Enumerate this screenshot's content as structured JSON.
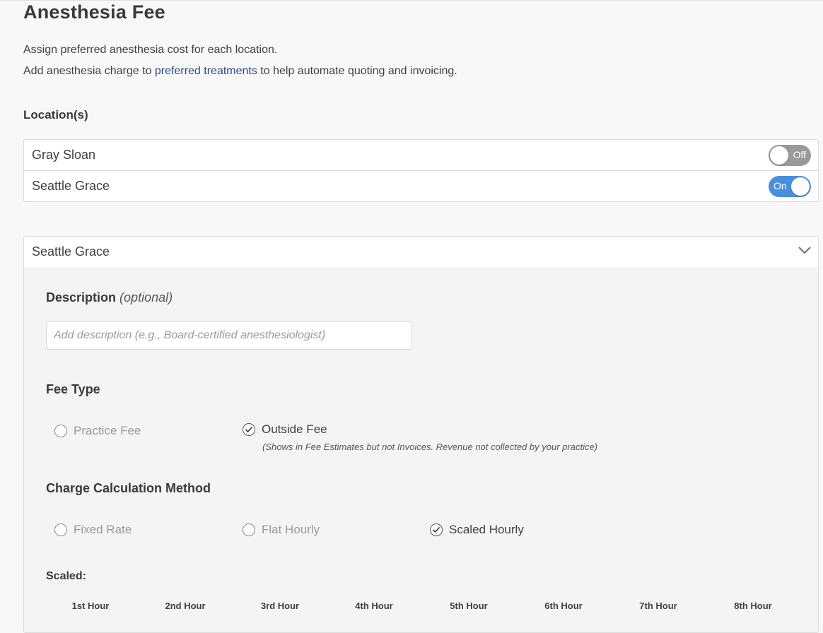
{
  "page": {
    "title": "Anesthesia Fee",
    "intro_line1": "Assign preferred anesthesia cost for each location.",
    "intro_line2_before": "Add anesthesia charge to ",
    "intro_link": "preferred treatments",
    "intro_line2_after": " to help automate quoting and invoicing."
  },
  "locations": {
    "label": "Location(s)",
    "items": [
      {
        "name": "Gray Sloan",
        "toggle_state": "off",
        "toggle_label": "Off"
      },
      {
        "name": "Seattle Grace",
        "toggle_state": "on",
        "toggle_label": "On"
      }
    ]
  },
  "panel": {
    "header": "Seattle Grace",
    "description": {
      "label": "Description",
      "optional": "(optional)",
      "placeholder": "Add description (e.g., Board-certified anesthesiologist)",
      "value": ""
    },
    "fee_type": {
      "label": "Fee Type",
      "options": [
        {
          "label": "Practice Fee",
          "selected": false
        },
        {
          "label": "Outside Fee",
          "selected": true
        }
      ],
      "outside_note": "(Shows in Fee Estimates but not Invoices. Revenue not collected by your practice)"
    },
    "charge_method": {
      "label": "Charge Calculation Method",
      "options": [
        {
          "label": "Fixed Rate",
          "selected": false
        },
        {
          "label": "Flat Hourly",
          "selected": false
        },
        {
          "label": "Scaled Hourly",
          "selected": true
        }
      ]
    },
    "scaled": {
      "label": "Scaled:",
      "hours": [
        "1st Hour",
        "2nd Hour",
        "3rd Hour",
        "4th Hour",
        "5th Hour",
        "6th Hour",
        "7th Hour",
        "8th Hour"
      ]
    }
  },
  "colors": {
    "toggle_on": "#4a8fdc",
    "toggle_off": "#9a9a9a",
    "link": "#2a4a8a"
  },
  "icons": {
    "collapse": "chevron-down-icon",
    "radio_checked": "check-icon"
  }
}
